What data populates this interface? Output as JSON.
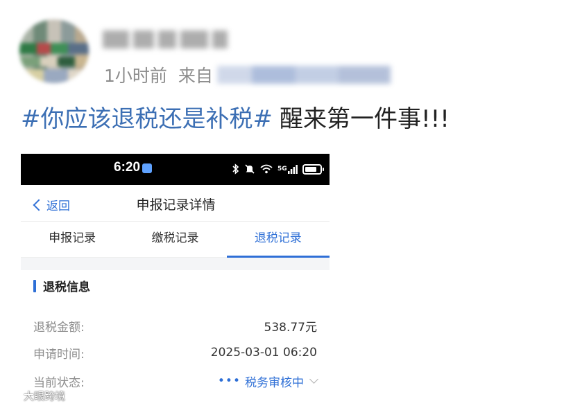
{
  "post": {
    "time": "1小时前",
    "source_prefix": "来自",
    "hashtag": "#你应该退税还是补税#",
    "text": "醒来第一件事!!!"
  },
  "phone": {
    "status_bar": {
      "time": "6:20",
      "icons": [
        "bluetooth-icon",
        "mute-icon",
        "wifi-icon",
        "5g-signal-icon",
        "battery-icon"
      ],
      "network": "5G"
    },
    "nav": {
      "back_label": "返回",
      "title": "申报记录详情"
    },
    "tabs": [
      {
        "label": "申报记录",
        "active": false
      },
      {
        "label": "缴税记录",
        "active": false
      },
      {
        "label": "退税记录",
        "active": true
      }
    ],
    "section_title": "退税信息",
    "fields": [
      {
        "label": "退税金额:",
        "value": "538.77元"
      },
      {
        "label": "申请时间:",
        "value": "2025-03-01 06:20"
      },
      {
        "label": "当前状态:",
        "value": "税务审核中",
        "prefix": "•••"
      }
    ],
    "accent_color": "#2e6fd6"
  },
  "watermark": {
    "text": "大眼跨境"
  },
  "colors": {
    "hashtag": "#3c6fb4",
    "meta_text": "#8c8c8c"
  }
}
